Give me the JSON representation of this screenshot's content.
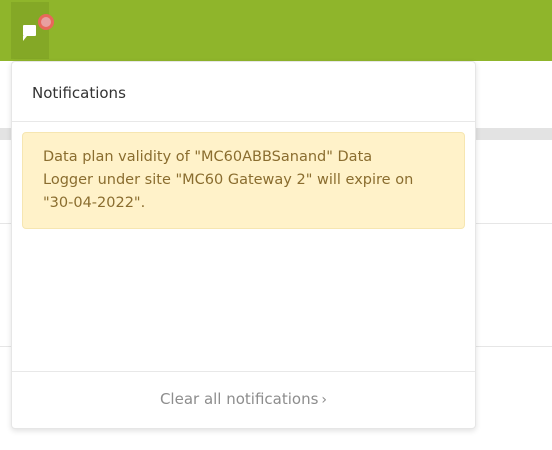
{
  "topbar": {
    "notification_icon": "flag-notification-icon",
    "accent": "#8fb52b"
  },
  "notifications": {
    "title": "Notifications",
    "items": [
      {
        "message": "Data plan validity of \"MC60ABBSanand\" Data Logger under site \"MC60 Gateway 2\" will expire on \"30-04-2022\"."
      }
    ],
    "clear_label": "Clear all notifications",
    "clear_chevron": "›"
  }
}
